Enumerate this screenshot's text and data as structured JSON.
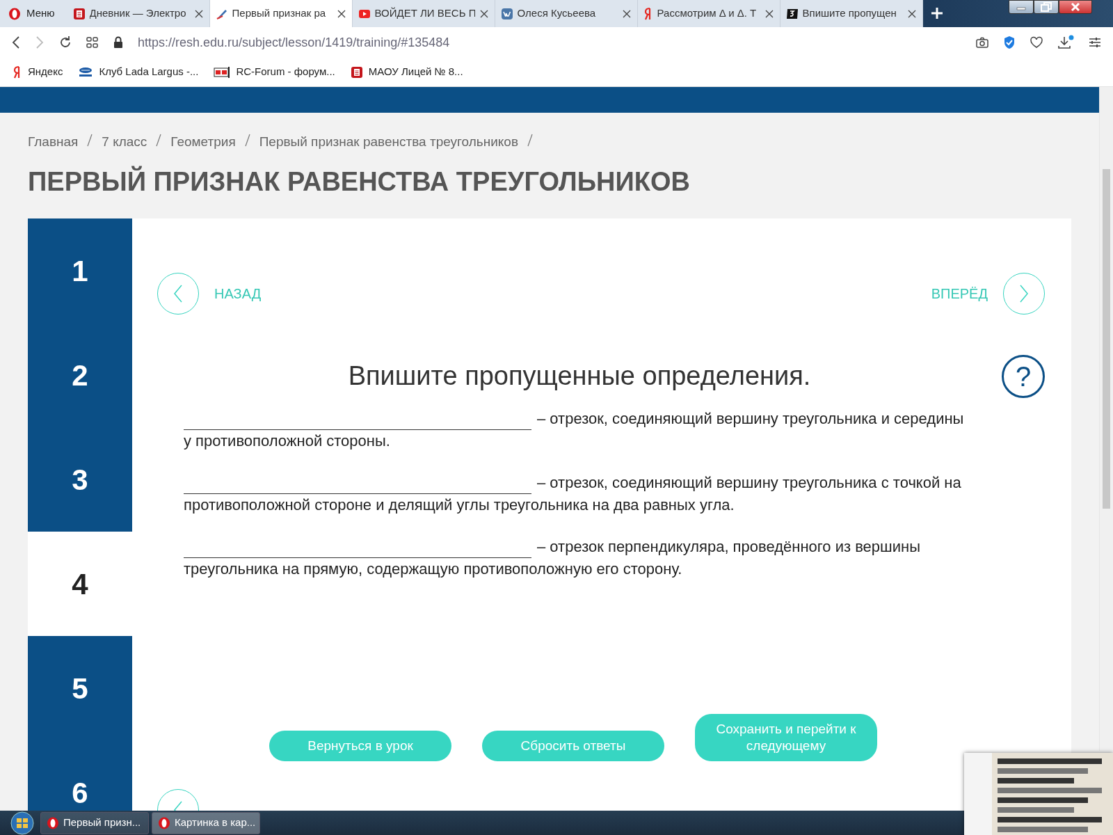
{
  "browser": {
    "menu_label": "Меню",
    "tabs": [
      {
        "kind": "diary",
        "title": "Дневник — Электро",
        "selected": false
      },
      {
        "kind": "lesson",
        "title": "Первый признак ра",
        "selected": true
      },
      {
        "kind": "video",
        "title": "ВОЙДЕТ ЛИ ВЕСЬ П",
        "selected": false
      },
      {
        "kind": "vk",
        "title": "Олеся Кусьеева",
        "selected": false
      },
      {
        "kind": "yandex",
        "title": "Рассмотрим Δ и Δ. Т",
        "selected": false
      },
      {
        "kind": "number",
        "title": "Впишите пропущен",
        "selected": false
      }
    ],
    "url": "https://resh.edu.ru/subject/lesson/1419/training/#135484",
    "bookmarks": [
      {
        "kind": "yandex",
        "title": "Яндекс"
      },
      {
        "kind": "lada",
        "title": "Клуб Lada Largus -..."
      },
      {
        "kind": "rc",
        "title": "RC-Forum - форум..."
      },
      {
        "kind": "diary",
        "title": "МАОУ Лицей № 8..."
      }
    ]
  },
  "page": {
    "breadcrumbs": [
      "Главная",
      "7 класс",
      "Геометрия",
      "Первый признак равенства треугольников"
    ],
    "title": "ПЕРВЫЙ ПРИЗНАК РАВЕНСТВА ТРЕУГОЛЬНИКОВ",
    "steps": [
      {
        "label": "1",
        "selected": false
      },
      {
        "label": "2",
        "selected": false
      },
      {
        "label": "3",
        "selected": false
      },
      {
        "label": "4",
        "selected": true
      },
      {
        "label": "5",
        "selected": false
      },
      {
        "label": "6",
        "selected": false
      }
    ],
    "back_label": "НАЗАД",
    "forward_label": "ВПЕРЁД",
    "question": "Впишите пропущенные определения.",
    "help_label": "?",
    "items": [
      {
        "text": "– отрезок, соединяющий вершину треугольника и середины",
        "text_continued": "у противоположной стороны."
      },
      {
        "text": "– отрезок, соединяющий вершину треугольника с точкой на",
        "text_continued": "противоположной стороне и делящий углы треугольника на два равных угла."
      },
      {
        "text": "– отрезок перпендикуляра, проведённого из вершины",
        "text_continued": "треугольника на прямую, содержащую противоположную его сторону."
      }
    ],
    "buttons": [
      "Вернуться в урок",
      "Сбросить ответы",
      "Сохранить и перейти к следующему"
    ]
  },
  "taskbar": [
    {
      "title": "Первый призн...",
      "selected": false
    },
    {
      "title": "Картинка в кар...",
      "selected": true
    }
  ]
}
